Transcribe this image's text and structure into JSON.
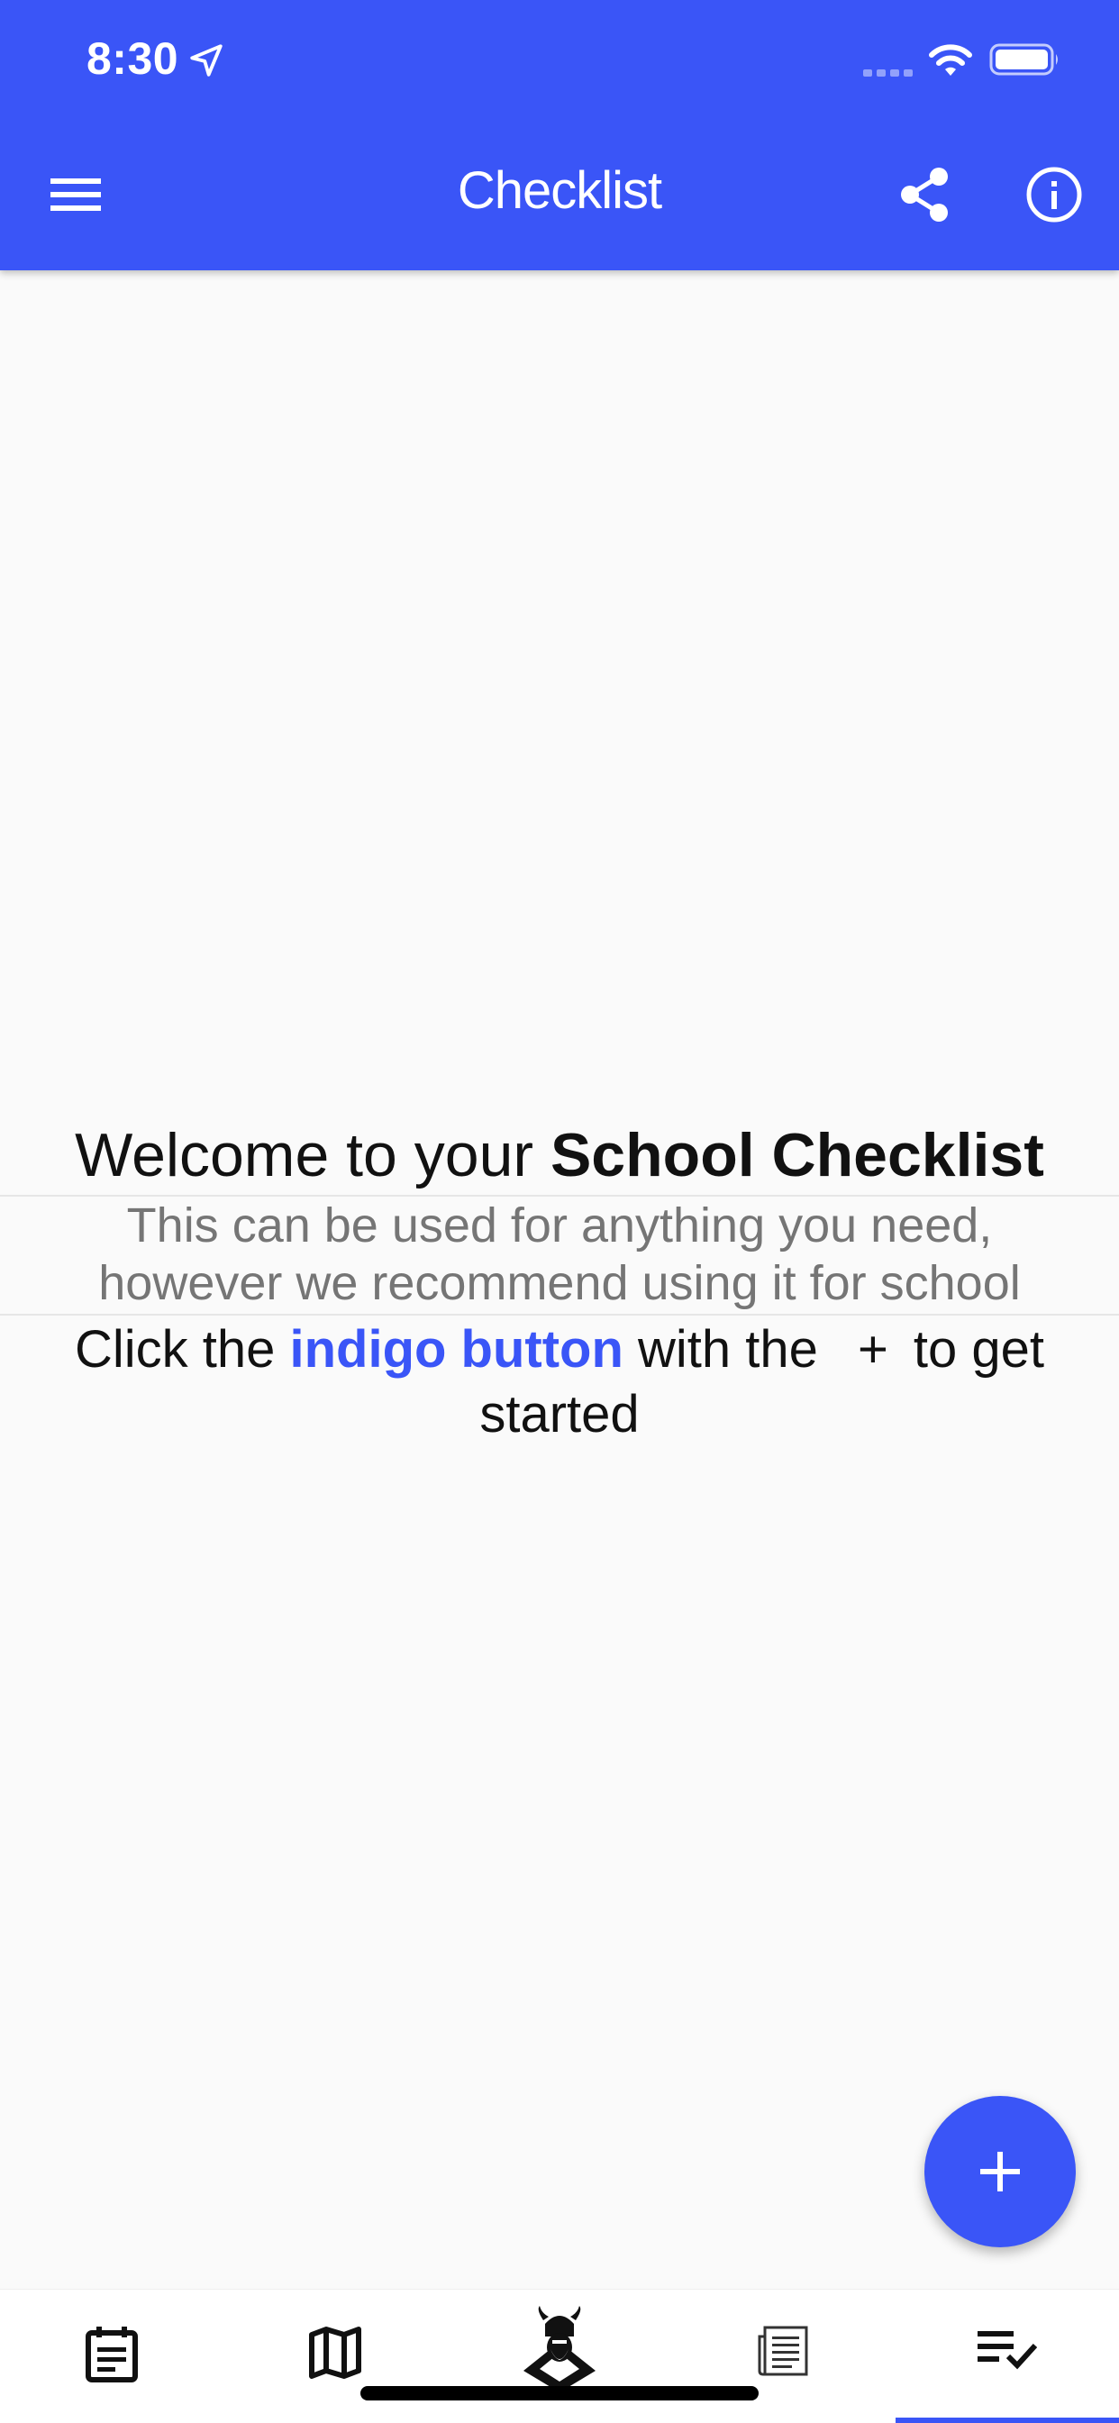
{
  "status_bar": {
    "time": "8:30",
    "location_icon": "location-arrow-icon",
    "signal_icon": "cellular-signal-icon",
    "wifi_icon": "wifi-icon",
    "battery_icon": "battery-icon"
  },
  "app_bar": {
    "title": "Checklist",
    "menu_icon": "hamburger-menu-icon",
    "share_icon": "share-icon",
    "info_icon": "info-icon",
    "background_color": "#3a55f7"
  },
  "welcome": {
    "title_prefix": "Welcome to your ",
    "title_bold": "School Checklist",
    "subtitle_line1": "This can be used for anything you need,",
    "subtitle_line2": "however we recommend using it for school",
    "cta_prefix": "Click the ",
    "cta_highlight": "indigo button",
    "cta_middle": " with the ",
    "cta_symbol": "+",
    "cta_suffix": "to get started"
  },
  "fab": {
    "icon": "plus-icon"
  },
  "bottom_nav": {
    "items": [
      {
        "icon": "calendar-notes-icon",
        "active": false
      },
      {
        "icon": "map-icon",
        "active": false
      },
      {
        "icon": "viking-logo-icon",
        "active": false
      },
      {
        "icon": "document-icon",
        "active": false
      },
      {
        "icon": "playlist-check-icon",
        "active": true
      }
    ]
  },
  "colors": {
    "accent": "#3a55f7",
    "background": "#fafafa",
    "subtitle_text": "#757575"
  }
}
